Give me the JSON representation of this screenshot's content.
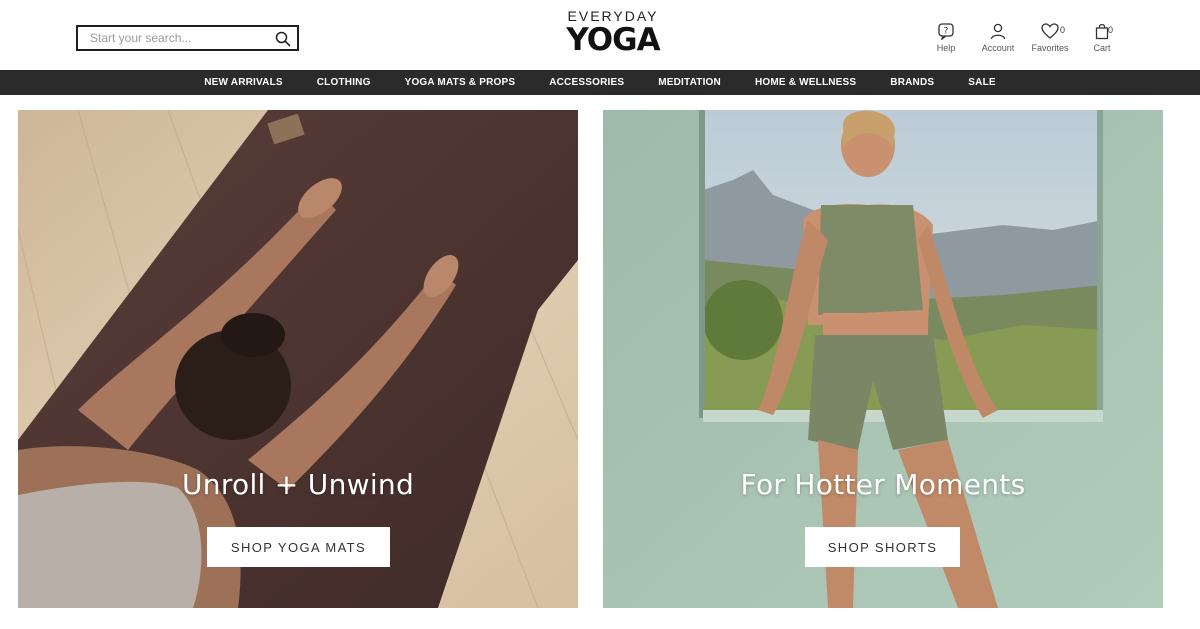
{
  "header": {
    "search": {
      "placeholder": "Start your search..."
    },
    "logo": {
      "top": "EVERYDAY",
      "main": "YOGA"
    },
    "utils": {
      "help": {
        "label": "Help"
      },
      "account": {
        "label": "Account"
      },
      "favorites": {
        "label": "Favorites",
        "count": "0"
      },
      "cart": {
        "label": "Cart",
        "count": "0"
      }
    }
  },
  "nav": {
    "items": [
      "NEW ARRIVALS",
      "CLOTHING",
      "YOGA MATS & PROPS",
      "ACCESSORIES",
      "MEDITATION",
      "HOME & WELLNESS",
      "BRANDS",
      "SALE"
    ]
  },
  "hero": {
    "left": {
      "headline": "Unroll + Unwind",
      "cta": "SHOP YOGA MATS"
    },
    "right": {
      "headline": "For Hotter Moments",
      "cta": "SHOP SHORTS"
    }
  },
  "colors": {
    "nav_bg": "#2b2b2b",
    "wood_floor": "#d9c3a5",
    "mat": "#4a3330",
    "wall": "#a9c3b3",
    "sky": "#c4d2dc"
  }
}
